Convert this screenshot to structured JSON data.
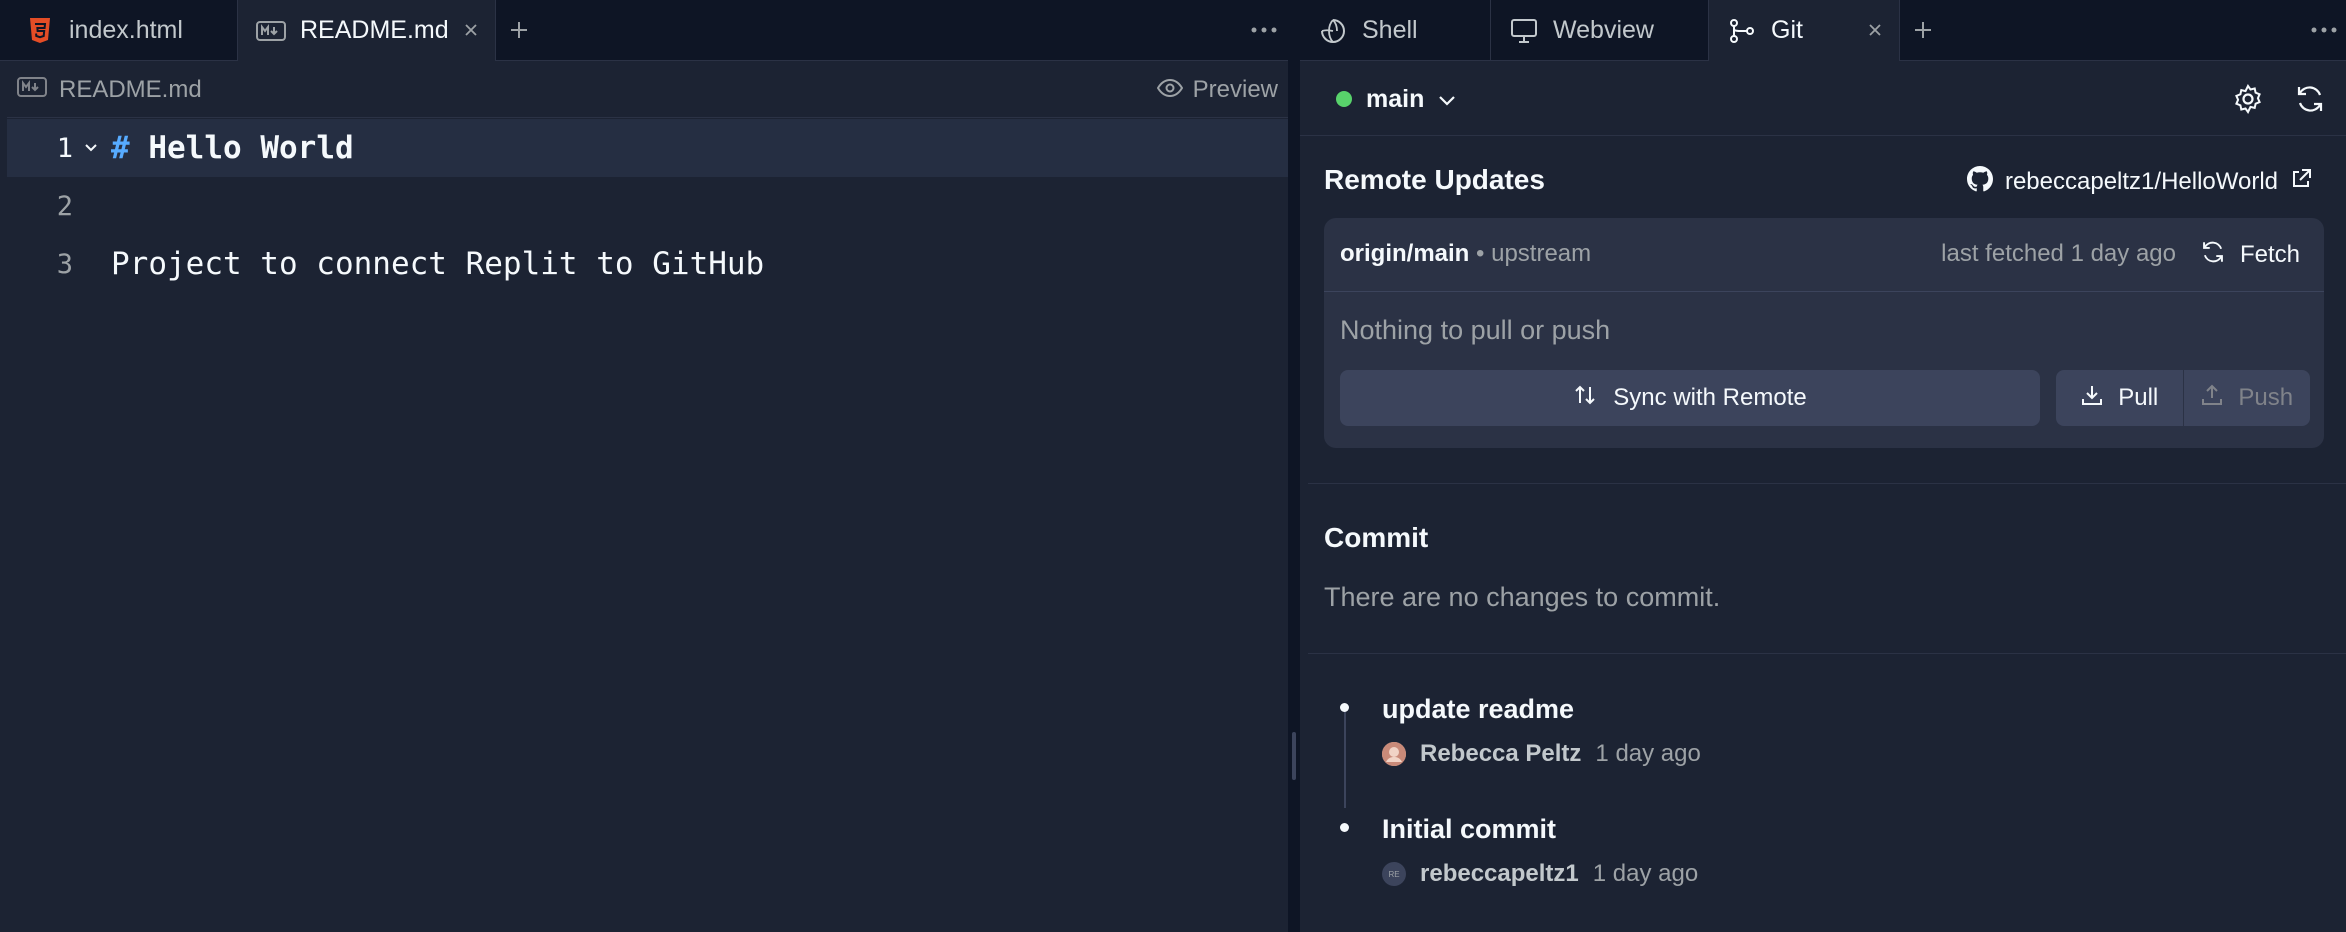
{
  "left": {
    "tabs": [
      {
        "label": "index.html",
        "icon": "html5-icon"
      },
      {
        "label": "README.md",
        "icon": "markdown-icon"
      }
    ],
    "filebar": {
      "filename": "README.md",
      "preview_label": "Preview"
    },
    "editor": {
      "lines": [
        {
          "number": "1",
          "hash": "#",
          "heading": "Hello World"
        },
        {
          "number": "2",
          "text": ""
        },
        {
          "number": "3",
          "text": "Project to connect Replit to GitHub"
        }
      ]
    }
  },
  "right": {
    "tabs": [
      {
        "label": "Shell",
        "icon": "shell-icon"
      },
      {
        "label": "Webview",
        "icon": "monitor-icon"
      },
      {
        "label": "Git",
        "icon": "git-branch-icon"
      }
    ],
    "branch": "main",
    "remote": {
      "title": "Remote Updates",
      "repo": "rebeccapeltz1/HelloWorld",
      "tracking_branch": "origin/main",
      "upstream_label": "upstream",
      "last_fetched": "last fetched 1 day ago",
      "fetch_label": "Fetch",
      "status": "Nothing to pull or push",
      "sync_label": "Sync with Remote",
      "pull_label": "Pull",
      "push_label": "Push"
    },
    "commit": {
      "title": "Commit",
      "empty_message": "There are no changes to commit."
    },
    "history": [
      {
        "message": "update readme",
        "author": "Rebecca Peltz",
        "time": "1 day ago",
        "avatar_text": ""
      },
      {
        "message": "Initial commit",
        "author": "rebeccapeltz1",
        "time": "1 day ago",
        "avatar_text": "RE"
      }
    ]
  },
  "colors": {
    "background": "#1c2333",
    "surface": "#2b3245",
    "accent_blue": "#57abff",
    "status_green": "#58d26b",
    "html_orange": "#e44d26"
  }
}
